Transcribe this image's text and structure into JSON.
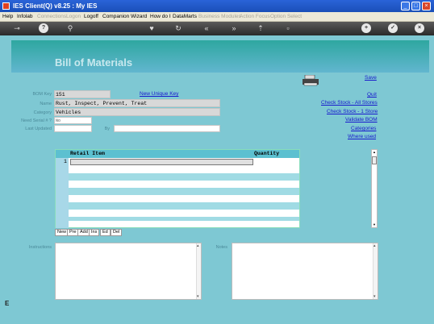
{
  "window": {
    "title": "IES Client(Q) v8.25 : My IES",
    "min": "_",
    "max": "□",
    "close": "×"
  },
  "menu": [
    {
      "label": "Help",
      "enabled": true
    },
    {
      "label": "Infolab",
      "enabled": true
    },
    {
      "label": "Connections",
      "enabled": false
    },
    {
      "label": "Logon",
      "enabled": false
    },
    {
      "label": "Logoff",
      "enabled": true
    },
    {
      "label": "Companion",
      "enabled": true
    },
    {
      "label": "Wizard",
      "enabled": true
    },
    {
      "label": "How do I",
      "enabled": true
    },
    {
      "label": "DataMarts",
      "enabled": true
    },
    {
      "label": "Business Modules",
      "enabled": false
    },
    {
      "label": "Action Focus",
      "enabled": false
    },
    {
      "label": "Option Select",
      "enabled": false
    }
  ],
  "toolbar": {
    "key": "⊸",
    "help": "?",
    "search": "⚲",
    "heart": "♥",
    "refresh": "↻",
    "back": "«",
    "forward": "»",
    "gap1": "⇡",
    "doc": "▫",
    "add": "+",
    "ok": "✓",
    "close": "×"
  },
  "page": {
    "title": "Bill of Materials"
  },
  "form": {
    "bom_key_label": "BOM Key",
    "bom_key_value": "151",
    "new_unique_key": "New Unique Key",
    "name_label": "Name",
    "name_value": "Rust, Inspect, Prevent, Treat",
    "category_label": "Category",
    "category_value": "Vehicles",
    "serial_label": "Need Serial # ?",
    "serial_value": "No",
    "last_updated_label": "Last Updated",
    "last_updated_value": "",
    "by_label": "By",
    "by_value": ""
  },
  "actions": {
    "save": "Save",
    "quit": "Quit",
    "check_all": "Check Stock - All Stores",
    "check_one": "Check Stock - 1 Store",
    "validate": "Validate BOM",
    "categories": "Categories",
    "where_used": "Where used"
  },
  "grid": {
    "columns": [
      "Retail Item",
      "Quantity"
    ],
    "first_row_number": "1",
    "row_buttons": [
      "New",
      "Pre",
      "Add",
      "Ins",
      "Ed",
      "Del"
    ]
  },
  "instructions_label": "Instructions",
  "notes_label": "Notes",
  "left_stub_text": "E"
}
